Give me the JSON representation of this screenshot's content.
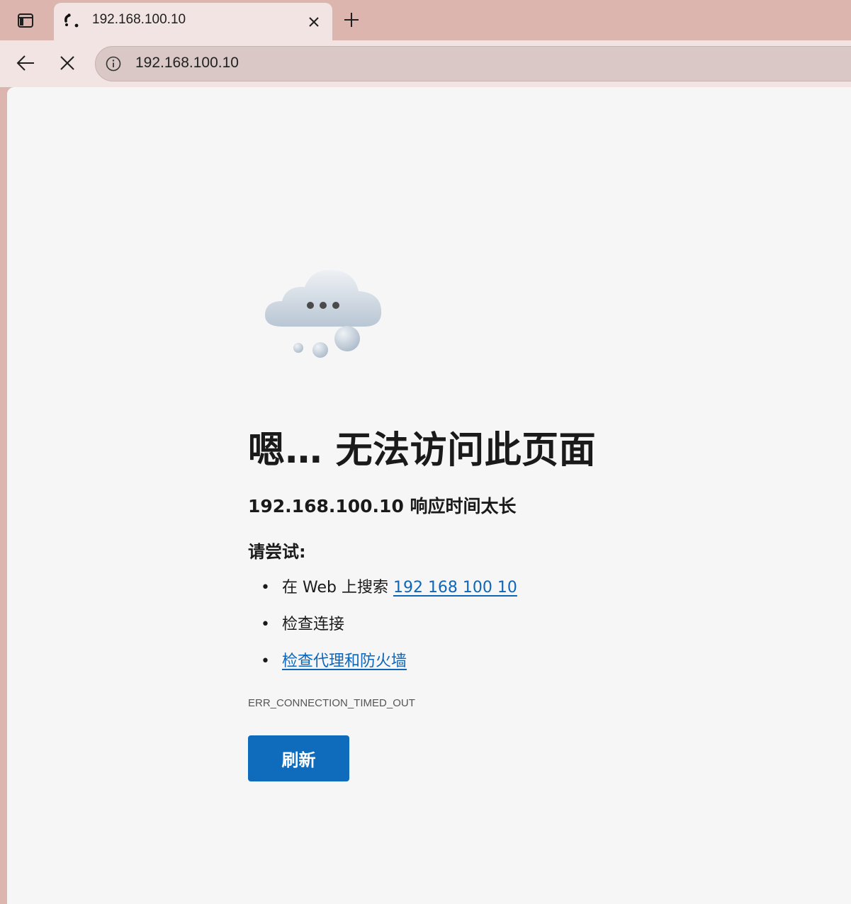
{
  "tab": {
    "title": "192.168.100.10",
    "close_glyph": "×",
    "new_tab_glyph": "+"
  },
  "toolbar": {
    "address": "192.168.100.10"
  },
  "icons": {
    "tab_actions": "tab-actions-icon",
    "favicon": "loading-favicon-icon",
    "back": "back-arrow-icon",
    "stop": "stop-icon",
    "info": "info-icon",
    "cloud": "cloud-illustration-icon"
  },
  "error": {
    "heading": "嗯… 无法访问此页面",
    "subheading": "192.168.100.10 响应时间太长",
    "try_label": "请尝试:",
    "suggestions": [
      {
        "prefix": "在 Web 上搜索 ",
        "link": "192 168 100 10"
      },
      {
        "prefix": "检查连接",
        "link": ""
      },
      {
        "prefix": "",
        "link": "检查代理和防火墙"
      }
    ],
    "bullet": "•",
    "code": "ERR_CONNECTION_TIMED_OUT",
    "refresh_label": "刷新"
  },
  "colors": {
    "tabstrip": "#dbb5ae",
    "toolbar": "#f1e4e3",
    "page_background": "#f6f6f6",
    "link": "#0f66b8",
    "button": "#0f6cbd"
  }
}
